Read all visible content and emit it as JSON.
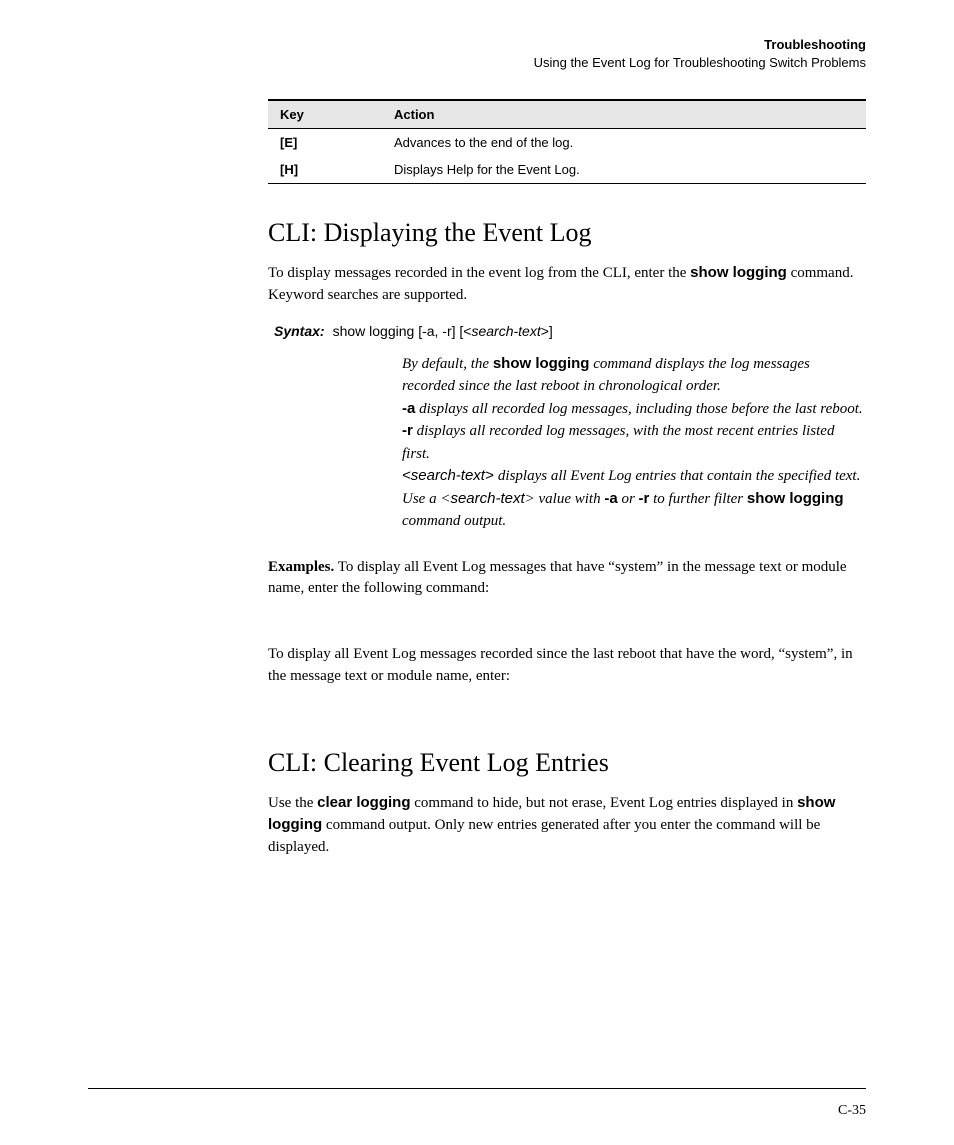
{
  "header": {
    "title": "Troubleshooting",
    "subtitle": "Using the Event Log for Troubleshooting Switch Problems"
  },
  "table": {
    "columns": [
      "Key",
      "Action"
    ],
    "rows": [
      {
        "key": "[E]",
        "action": "Advances to the end of the log."
      },
      {
        "key": "[H]",
        "action": "Displays Help for the Event Log."
      }
    ]
  },
  "section1": {
    "heading": "CLI: Displaying the Event Log",
    "intro_pre": "To display messages recorded in the event log from the CLI, enter the ",
    "intro_cmd": "show logging",
    "intro_post": " command. Keyword searches are supported.",
    "syntax_label": "Syntax:",
    "syntax_text": "show logging [-a, -r] [<",
    "syntax_search": "search-text",
    "syntax_text2": ">]",
    "desc": {
      "d1a": "By default, the ",
      "d1b": "show logging",
      "d1c": " command displays the log messages recorded since the last reboot in chronological order.",
      "d2a": "-a",
      "d2b": "  displays all recorded log messages, including those before the last reboot.",
      "d3a": "-r",
      "d3b": " displays all recorded log messages, with the most recent entries listed first.",
      "d4a": "<",
      "d4b": "search-text",
      "d4c": "> ",
      "d4d": "displays all Event Log entries that contain the specified text. Use a <",
      "d4e": "search-text",
      "d4f": "> value with ",
      "d4g": "-a",
      "d4h": " or ",
      "d4i": "-r",
      "d4j": " to further filter ",
      "d4k": "show logging",
      "d4l": " command output."
    },
    "examples_label": "Examples.",
    "examples_body": "  To display all Event Log messages that have “system” in the message text or module name, enter the following command:",
    "para2": "To display all Event Log messages recorded since the last reboot that have the word, “system”, in the message text or module name, enter:"
  },
  "section2": {
    "heading": "CLI: Clearing Event Log Entries",
    "p1a": "Use the ",
    "p1b": "clear logging",
    "p1c": " command to hide, but not erase, Event Log entries displayed in ",
    "p1d": "show logging",
    "p1e": " command output. Only new entries generated after you enter the command will be displayed."
  },
  "page_number": "C-35"
}
